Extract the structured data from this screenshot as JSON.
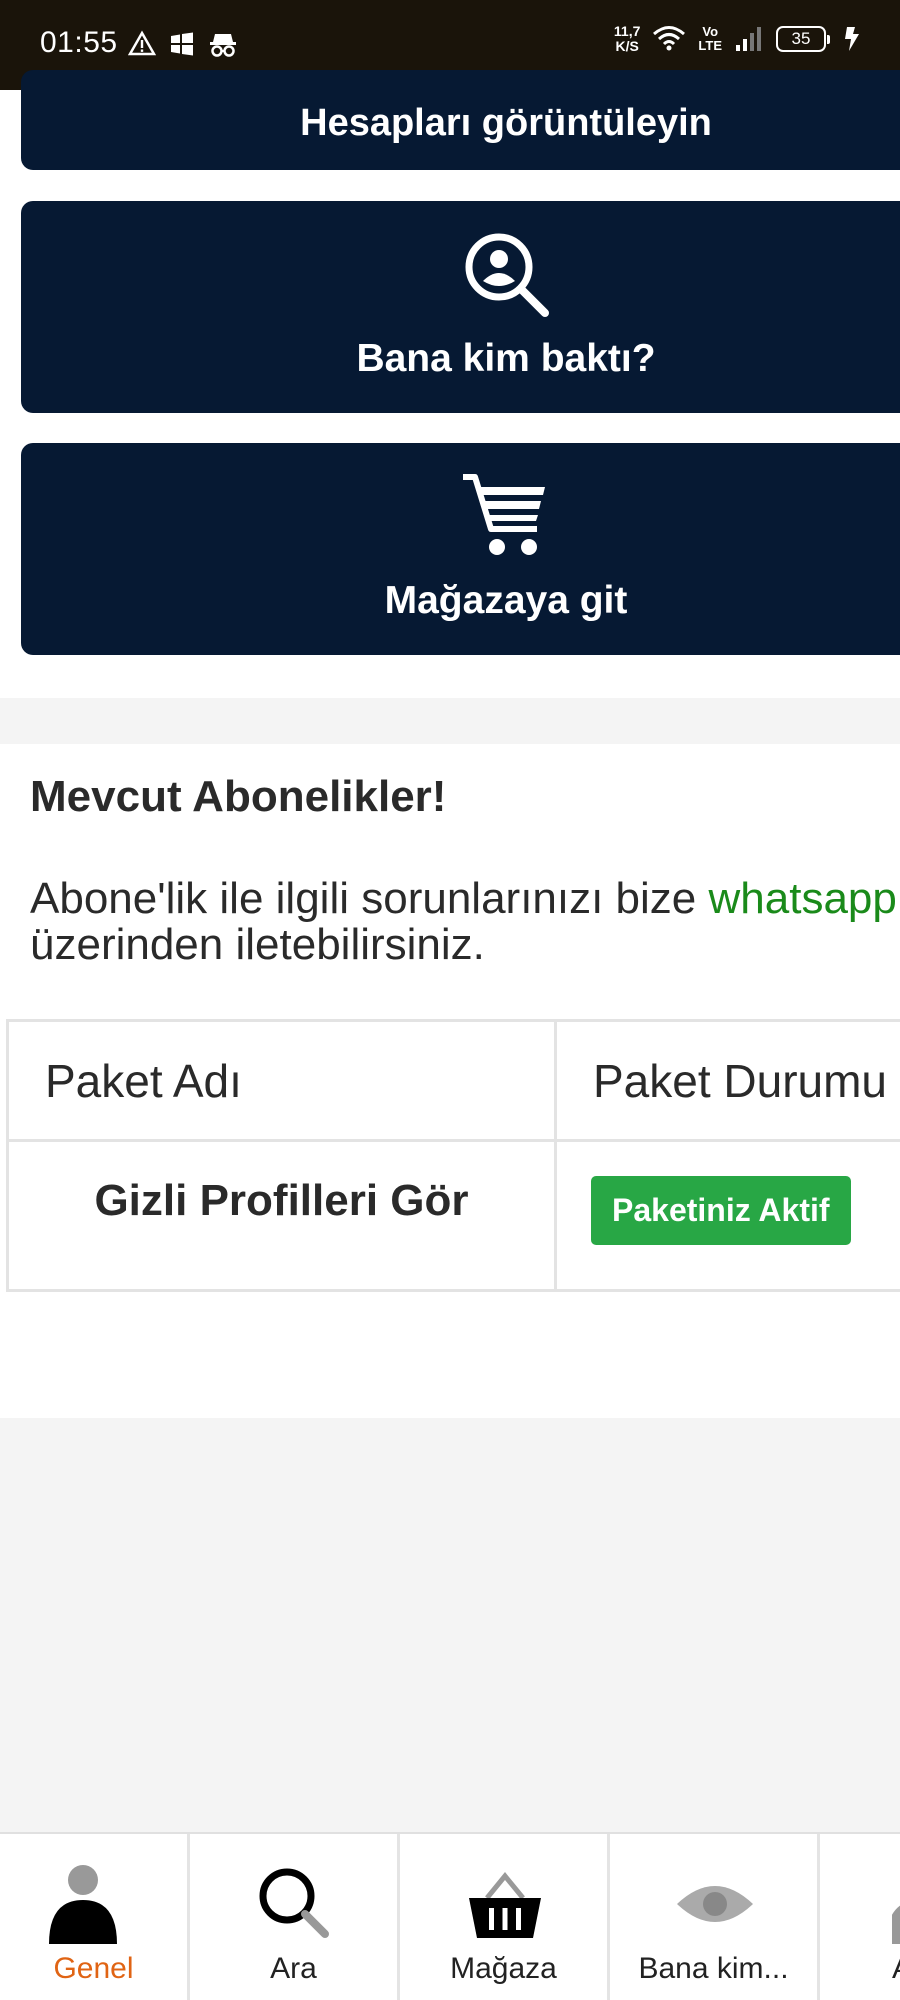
{
  "status_bar": {
    "time": "01:55",
    "net_speed_value": "11,7",
    "net_speed_unit": "K/S",
    "volte_top": "Vo",
    "volte_bottom": "LTE",
    "battery": "35"
  },
  "cards": {
    "accounts_label": "Hesapları görüntüleyin",
    "viewers_label": "Bana kim baktı?",
    "store_label": "Mağazaya git"
  },
  "subscriptions": {
    "title": "Mevcut Abonelikler!",
    "text_before_link": "Abone'lik ile ilgili sorunlarınızı bize ",
    "link_text": "whatsapp",
    "text_after_link": " üzerinden iletebilirsiniz.",
    "table": {
      "headers": [
        "Paket Adı",
        "Paket Durumu"
      ],
      "rows": [
        {
          "name": "Gizli Profilleri Gör",
          "status": "Paketiniz Aktif"
        }
      ]
    }
  },
  "colors": {
    "navy": "#061933",
    "status_green": "#28a745",
    "link_green": "#1a8a1a",
    "active_orange": "#e06414"
  },
  "bottom_nav": {
    "items": [
      {
        "label": "Genel",
        "icon": "person-icon",
        "active": true
      },
      {
        "label": "Ara",
        "icon": "search-icon",
        "active": false
      },
      {
        "label": "Mağaza",
        "icon": "basket-icon",
        "active": false
      },
      {
        "label": "Bana kim...",
        "icon": "eye-icon",
        "active": false
      },
      {
        "label": "A",
        "icon": "person-icon",
        "active": false
      }
    ]
  }
}
